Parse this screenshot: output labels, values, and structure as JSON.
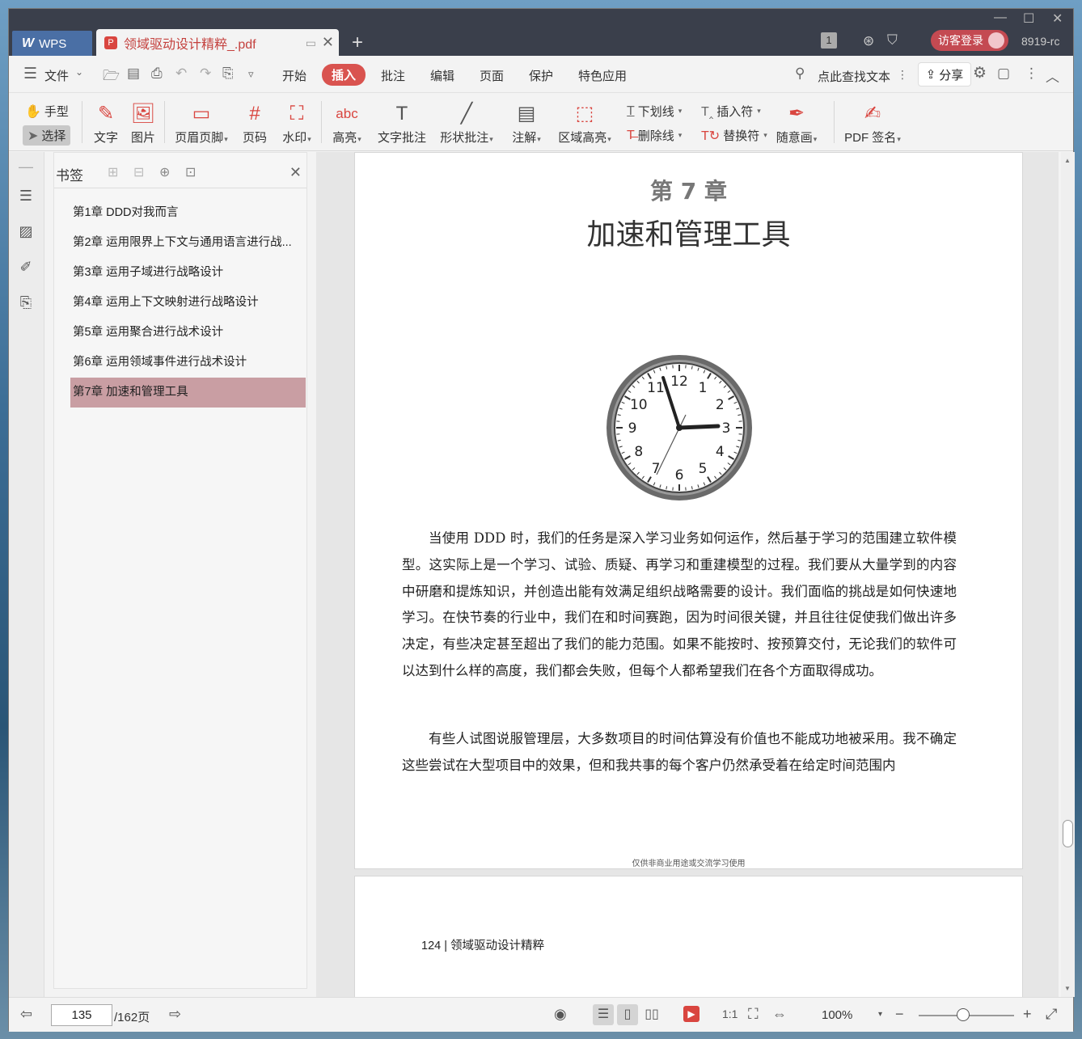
{
  "titlebar": {
    "app_label": "WPS",
    "doc_tab_name": "领域驱动设计精粹_.pdf",
    "page_badge": "1",
    "visitor_label": "访客登录",
    "version": "8919-rc"
  },
  "menubar": {
    "file_label": "文件",
    "items": [
      "开始",
      "插入",
      "批注",
      "编辑",
      "页面",
      "保护",
      "特色应用"
    ],
    "active_item": "插入",
    "search_label": "点此查找文本",
    "share_label": "分享"
  },
  "ribbon": {
    "hand": "手型",
    "select": "选择",
    "text": "文字",
    "image": "图片",
    "header_footer": "页眉页脚",
    "page_number": "页码",
    "watermark": "水印",
    "highlight": "高亮",
    "text_note": "文字批注",
    "shape_note": "形状批注",
    "annotation": "注解",
    "area_highlight": "区域高亮",
    "underline": "下划线",
    "strikethrough": "删除线",
    "insert_mark": "插入符",
    "replace_mark": "替换符",
    "freehand": "随意画",
    "pdf_sign": "PDF 签名"
  },
  "bookmarks": {
    "title": "书签",
    "items": [
      "第1章 DDD对我而言",
      "第2章 运用限界上下文与通用语言进行战...",
      "第3章 运用子域进行战略设计",
      "第4章 运用上下文映射进行战略设计",
      "第5章 运用聚合进行战术设计",
      "第6章 运用领域事件进行战术设计",
      "第7章 加速和管理工具"
    ],
    "selected_index": 6
  },
  "page": {
    "chapter_number": "第 7 章",
    "chapter_title": "加速和管理工具",
    "clock_hours": [
      "12",
      "1",
      "2",
      "3",
      "4",
      "5",
      "6",
      "7",
      "8",
      "9",
      "10",
      "11"
    ],
    "paragraph1": "当使用 DDD 时，我们的任务是深入学习业务如何运作，然后基于学习的范围建立软件模型。这实际上是一个学习、试验、质疑、再学习和重建模型的过程。我们要从大量学到的内容中研磨和提炼知识，并创造出能有效满足组织战略需要的设计。我们面临的挑战是如何快速地学习。在快节奏的行业中，我们在和时间赛跑，因为时间很关键，并且往往促使我们做出许多决定，有些决定甚至超出了我们的能力范围。如果不能按时、按预算交付，无论我们的软件可以达到什么样的高度，我们都会失败，但每个人都希望我们在各个方面取得成功。",
    "paragraph2": "有些人试图说服管理层，大多数项目的时间估算没有价值也不能成功地被采用。我不确定这些尝试在大型项目中的效果，但和我共事的每个客户仍然承受着在给定时间范围内",
    "footer": "仅供非商业用途或交流学习使用",
    "next_page_header": "124 | 领域驱动设计精粹"
  },
  "statusbar": {
    "current_page": "135",
    "total_pages": "/162页",
    "zoom": "100%"
  }
}
